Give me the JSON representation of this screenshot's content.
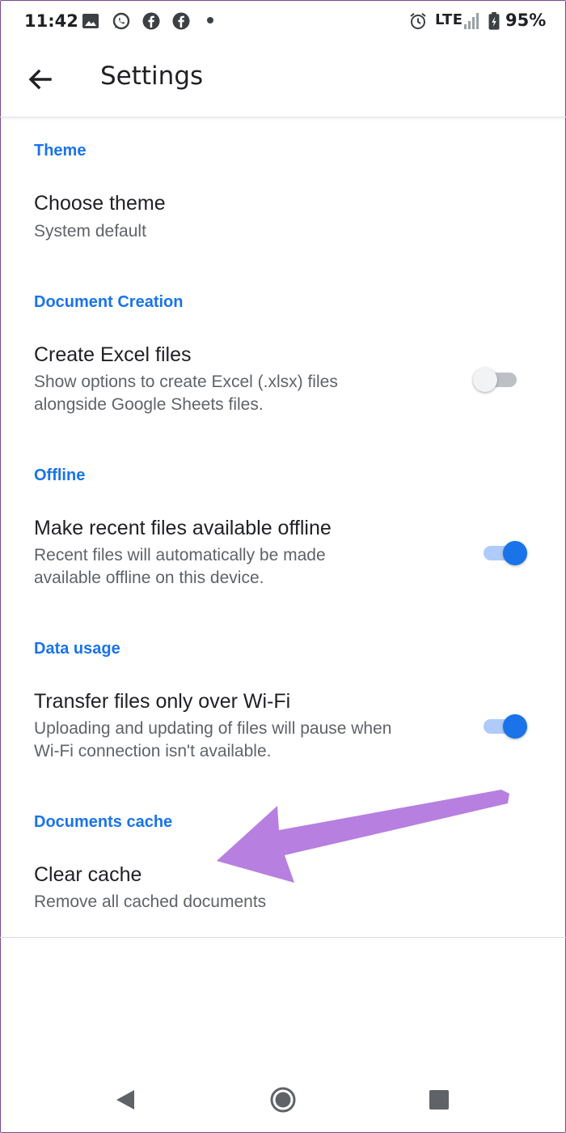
{
  "status_bar": {
    "time": "11:42",
    "icons": [
      "image-icon",
      "whatsapp-icon",
      "facebook-icon",
      "facebook-icon",
      "notification-dot",
      "alarm-icon",
      "signal-icon",
      "battery-charging-icon"
    ],
    "network": "LTE",
    "battery": "95%"
  },
  "app_bar": {
    "back_icon": "arrow-back-icon",
    "title": "Settings"
  },
  "sections": {
    "theme": {
      "header": "Theme",
      "item": {
        "title": "Choose theme",
        "summary": "System default"
      }
    },
    "document_creation": {
      "header": "Document Creation",
      "item": {
        "title": "Create Excel files",
        "summary_lines": [
          "Show options to create Excel (.xlsx) files",
          "alongside Google Sheets files."
        ],
        "enabled": false
      }
    },
    "offline": {
      "header": "Offline",
      "item": {
        "title": "Make recent files available offline",
        "summary_lines": [
          "Recent files will automatically be made",
          "available offline on this device."
        ],
        "enabled": true
      }
    },
    "data_usage": {
      "header": "Data usage",
      "item": {
        "title": "Transfer files only over Wi-Fi",
        "summary_lines": [
          "Uploading and updating of files will pause when",
          "Wi-Fi connection isn't available."
        ],
        "enabled": true
      }
    },
    "documents_cache": {
      "header": "Documents cache",
      "item": {
        "title": "Clear cache",
        "summary": "Remove all cached documents"
      }
    }
  },
  "colors": {
    "accent": "#1a73e8",
    "annotation_arrow": "#b77fe0"
  },
  "nav_bar": {
    "icons": [
      "nav-back-icon",
      "nav-home-icon",
      "nav-recents-icon"
    ]
  }
}
